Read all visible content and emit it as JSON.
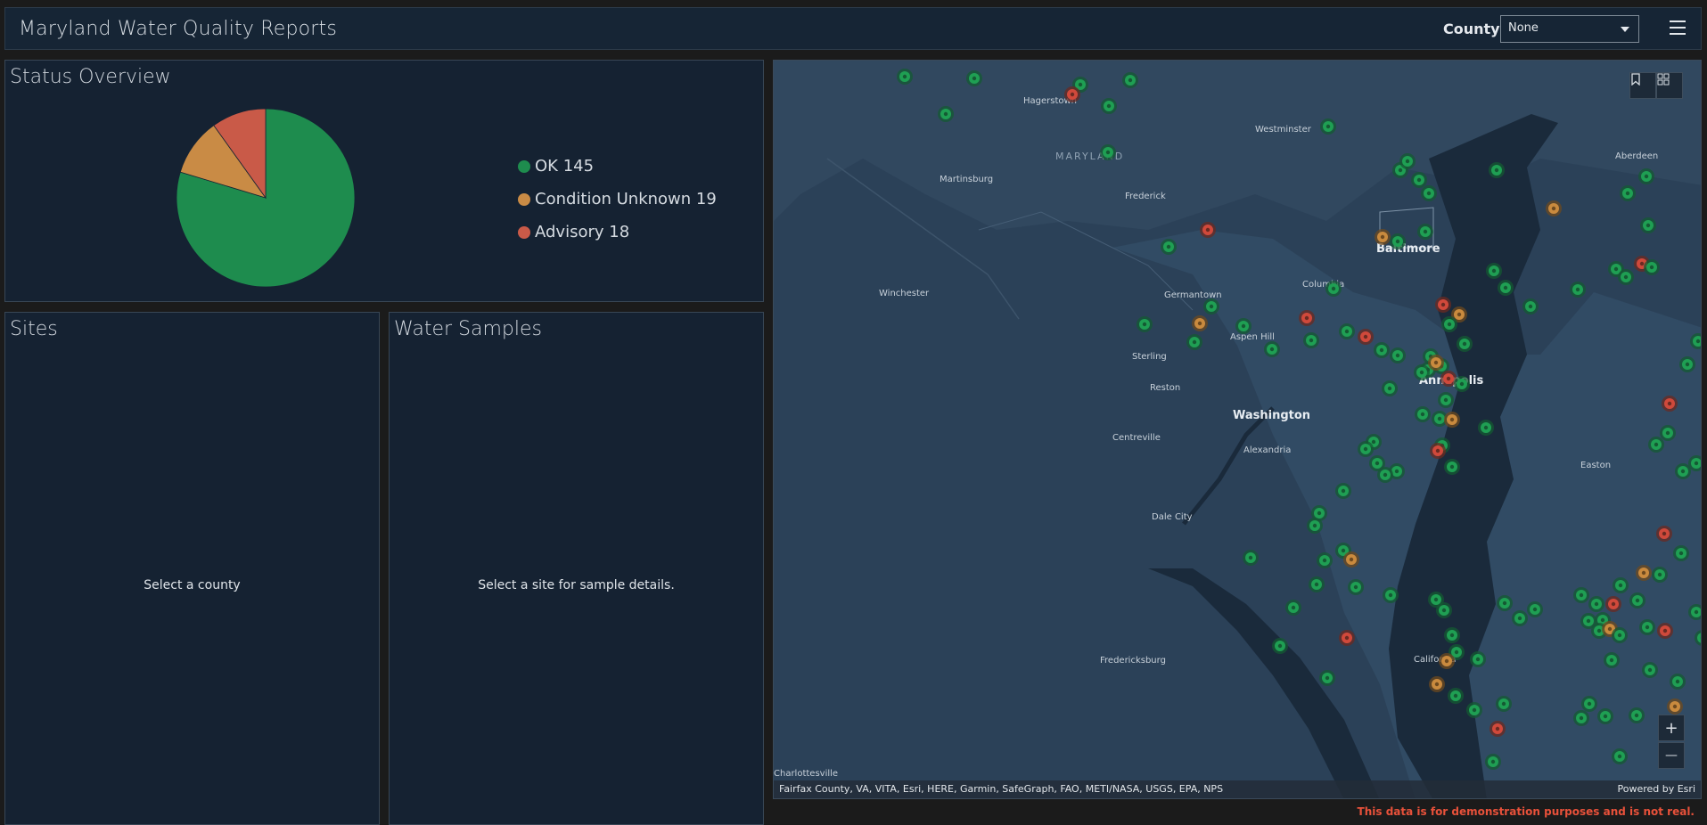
{
  "header": {
    "title": "Maryland Water Quality Reports",
    "county_label": "County",
    "county_value": "None"
  },
  "status_panel": {
    "title": "Status Overview",
    "legend": [
      {
        "label": "OK 145",
        "color": "#1e8c4e"
      },
      {
        "label": "Condition Unknown 19",
        "color": "#c98b45"
      },
      {
        "label": "Advisory 18",
        "color": "#c95a48"
      }
    ]
  },
  "chart_data": {
    "type": "pie",
    "categories": [
      "OK",
      "Condition Unknown",
      "Advisory"
    ],
    "values": [
      145,
      19,
      18
    ],
    "colors": [
      "#1e8c4e",
      "#c98b45",
      "#c95a48"
    ],
    "title": "Status Overview",
    "legend_position": "right"
  },
  "sites_panel": {
    "title": "Sites",
    "placeholder": "Select a county"
  },
  "samples_panel": {
    "title": "Water Samples",
    "placeholder": "Select a site for sample details."
  },
  "map": {
    "labels": [
      "Hagerstown",
      "Westminster",
      "Aberdeen",
      "MARYLAND",
      "Martinsburg",
      "Frederick",
      "Baltimore",
      "Winchester",
      "Germantown",
      "Columbia",
      "Aspen Hill",
      "Sterling",
      "Reston",
      "Washington",
      "Annapolis",
      "Centreville",
      "Alexandria",
      "Easton",
      "Dale City",
      "California",
      "Fredericksburg",
      "Charlottesville"
    ],
    "attribution": "Fairfax County, VA, VITA, Esri, HERE, Garmin, SafeGraph, FAO, METI/NASA, USGS, EPA, NPS",
    "powered_by": "Powered by Esri",
    "zoom_in": "+",
    "zoom_out": "—",
    "disclaimer": "This data is for demonstration purposes and is not real."
  }
}
